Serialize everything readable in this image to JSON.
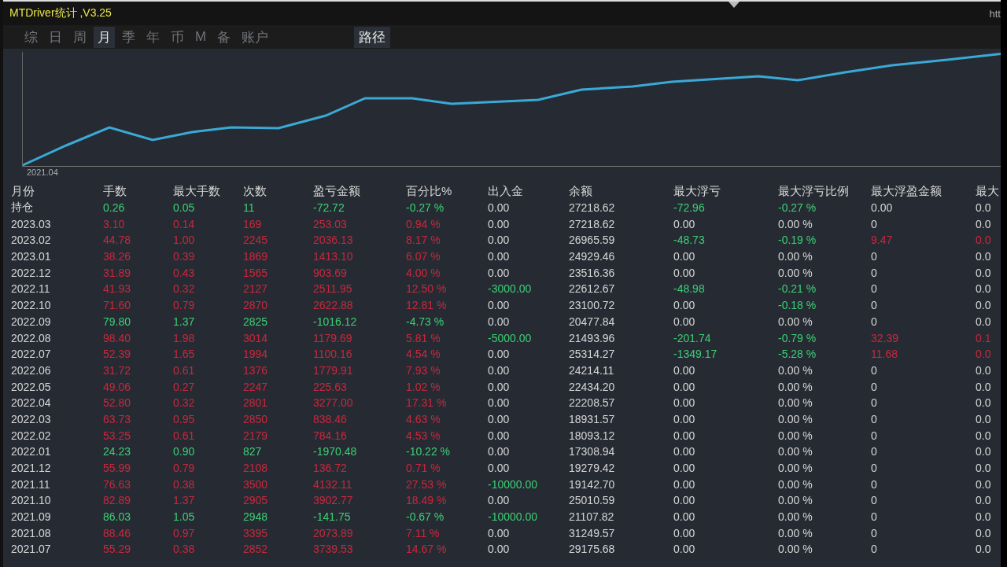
{
  "window": {
    "title": "MTDriver统计 ,V3.25",
    "corner_text": "htt"
  },
  "tabs": [
    {
      "label": "综",
      "selected": false
    },
    {
      "label": "日",
      "selected": false
    },
    {
      "label": "周",
      "selected": false
    },
    {
      "label": "月",
      "selected": true
    },
    {
      "label": "季",
      "selected": false
    },
    {
      "label": "年",
      "selected": false
    },
    {
      "label": "币",
      "selected": false
    },
    {
      "label": "M",
      "selected": false
    },
    {
      "label": "备",
      "selected": false
    },
    {
      "label": "账户",
      "selected": false
    }
  ],
  "path_button": "路径",
  "chart": {
    "start_label": "2021.04"
  },
  "table": {
    "columns": [
      "月份",
      "手数",
      "最大手数",
      "次数",
      "盈亏金额",
      "百分比%",
      "出入金",
      "余额",
      "最大浮亏",
      "最大浮亏比例",
      "最大浮盈金额",
      "最大"
    ],
    "rows": [
      {
        "cells": [
          {
            "text": "持仓",
            "color": "#d6d6d6"
          },
          {
            "text": "0.26",
            "color": "#3ccf74"
          },
          {
            "text": "0.05",
            "color": "#3ccf74"
          },
          {
            "text": "11",
            "color": "#3ccf74"
          },
          {
            "text": "-72.72",
            "color": "#3ccf74"
          },
          {
            "text": "-0.27 %",
            "color": "#3ccf74"
          },
          {
            "text": "0.00",
            "color": "#d6d6d6"
          },
          {
            "text": "27218.62",
            "color": "#d6d6d6"
          },
          {
            "text": "-72.96",
            "color": "#3ccf74"
          },
          {
            "text": "-0.27 %",
            "color": "#3ccf74"
          },
          {
            "text": "0.00",
            "color": "#d6d6d6"
          },
          {
            "text": "0.0",
            "color": "#d6d6d6"
          }
        ]
      },
      {
        "cells": [
          {
            "text": "2023.03",
            "color": "#d6d6d6"
          },
          {
            "text": "3.10",
            "color": "#c8283c"
          },
          {
            "text": "0.14",
            "color": "#c8283c"
          },
          {
            "text": "169",
            "color": "#c8283c"
          },
          {
            "text": "253.03",
            "color": "#c8283c"
          },
          {
            "text": "0.94 %",
            "color": "#c8283c"
          },
          {
            "text": "0.00",
            "color": "#d6d6d6"
          },
          {
            "text": "27218.62",
            "color": "#d6d6d6"
          },
          {
            "text": "0.00",
            "color": "#d6d6d6"
          },
          {
            "text": "0.00 %",
            "color": "#d6d6d6"
          },
          {
            "text": "0",
            "color": "#d6d6d6"
          },
          {
            "text": "0.0",
            "color": "#d6d6d6"
          }
        ]
      },
      {
        "cells": [
          {
            "text": "2023.02",
            "color": "#d6d6d6"
          },
          {
            "text": "44.78",
            "color": "#c8283c"
          },
          {
            "text": "1.00",
            "color": "#c8283c"
          },
          {
            "text": "2245",
            "color": "#c8283c"
          },
          {
            "text": "2036.13",
            "color": "#c8283c"
          },
          {
            "text": "8.17 %",
            "color": "#c8283c"
          },
          {
            "text": "0.00",
            "color": "#d6d6d6"
          },
          {
            "text": "26965.59",
            "color": "#d6d6d6"
          },
          {
            "text": "-48.73",
            "color": "#3ccf74"
          },
          {
            "text": "-0.19 %",
            "color": "#3ccf74"
          },
          {
            "text": "9.47",
            "color": "#c8283c"
          },
          {
            "text": "0.0",
            "color": "#c8283c"
          }
        ]
      },
      {
        "cells": [
          {
            "text": "2023.01",
            "color": "#d6d6d6"
          },
          {
            "text": "38.26",
            "color": "#c8283c"
          },
          {
            "text": "0.39",
            "color": "#c8283c"
          },
          {
            "text": "1869",
            "color": "#c8283c"
          },
          {
            "text": "1413.10",
            "color": "#c8283c"
          },
          {
            "text": "6.07 %",
            "color": "#c8283c"
          },
          {
            "text": "0.00",
            "color": "#d6d6d6"
          },
          {
            "text": "24929.46",
            "color": "#d6d6d6"
          },
          {
            "text": "0.00",
            "color": "#d6d6d6"
          },
          {
            "text": "0.00 %",
            "color": "#d6d6d6"
          },
          {
            "text": "0",
            "color": "#d6d6d6"
          },
          {
            "text": "0.0",
            "color": "#d6d6d6"
          }
        ]
      },
      {
        "cells": [
          {
            "text": "2022.12",
            "color": "#d6d6d6"
          },
          {
            "text": "31.89",
            "color": "#c8283c"
          },
          {
            "text": "0.43",
            "color": "#c8283c"
          },
          {
            "text": "1565",
            "color": "#c8283c"
          },
          {
            "text": "903.69",
            "color": "#c8283c"
          },
          {
            "text": "4.00 %",
            "color": "#c8283c"
          },
          {
            "text": "0.00",
            "color": "#d6d6d6"
          },
          {
            "text": "23516.36",
            "color": "#d6d6d6"
          },
          {
            "text": "0.00",
            "color": "#d6d6d6"
          },
          {
            "text": "0.00 %",
            "color": "#d6d6d6"
          },
          {
            "text": "0",
            "color": "#d6d6d6"
          },
          {
            "text": "0.0",
            "color": "#d6d6d6"
          }
        ]
      },
      {
        "cells": [
          {
            "text": "2022.11",
            "color": "#d6d6d6"
          },
          {
            "text": "41.93",
            "color": "#c8283c"
          },
          {
            "text": "0.32",
            "color": "#c8283c"
          },
          {
            "text": "2127",
            "color": "#c8283c"
          },
          {
            "text": "2511.95",
            "color": "#c8283c"
          },
          {
            "text": "12.50 %",
            "color": "#c8283c"
          },
          {
            "text": "-3000.00",
            "color": "#3ccf74"
          },
          {
            "text": "22612.67",
            "color": "#d6d6d6"
          },
          {
            "text": "-48.98",
            "color": "#3ccf74"
          },
          {
            "text": "-0.21 %",
            "color": "#3ccf74"
          },
          {
            "text": "0",
            "color": "#d6d6d6"
          },
          {
            "text": "0.0",
            "color": "#d6d6d6"
          }
        ]
      },
      {
        "cells": [
          {
            "text": "2022.10",
            "color": "#d6d6d6"
          },
          {
            "text": "71.60",
            "color": "#c8283c"
          },
          {
            "text": "0.79",
            "color": "#c8283c"
          },
          {
            "text": "2870",
            "color": "#c8283c"
          },
          {
            "text": "2622.88",
            "color": "#c8283c"
          },
          {
            "text": "12.81 %",
            "color": "#c8283c"
          },
          {
            "text": "0.00",
            "color": "#d6d6d6"
          },
          {
            "text": "23100.72",
            "color": "#d6d6d6"
          },
          {
            "text": "0.00",
            "color": "#d6d6d6"
          },
          {
            "text": "-0.18 %",
            "color": "#3ccf74"
          },
          {
            "text": "0",
            "color": "#d6d6d6"
          },
          {
            "text": "0.0",
            "color": "#d6d6d6"
          }
        ]
      },
      {
        "cells": [
          {
            "text": "2022.09",
            "color": "#d6d6d6"
          },
          {
            "text": "79.80",
            "color": "#3ccf74"
          },
          {
            "text": "1.37",
            "color": "#3ccf74"
          },
          {
            "text": "2825",
            "color": "#3ccf74"
          },
          {
            "text": "-1016.12",
            "color": "#3ccf74"
          },
          {
            "text": "-4.73 %",
            "color": "#3ccf74"
          },
          {
            "text": "0.00",
            "color": "#d6d6d6"
          },
          {
            "text": "20477.84",
            "color": "#d6d6d6"
          },
          {
            "text": "0.00",
            "color": "#d6d6d6"
          },
          {
            "text": "0.00 %",
            "color": "#d6d6d6"
          },
          {
            "text": "0",
            "color": "#d6d6d6"
          },
          {
            "text": "0.0",
            "color": "#d6d6d6"
          }
        ]
      },
      {
        "cells": [
          {
            "text": "2022.08",
            "color": "#d6d6d6"
          },
          {
            "text": "98.40",
            "color": "#c8283c"
          },
          {
            "text": "1.98",
            "color": "#c8283c"
          },
          {
            "text": "3014",
            "color": "#c8283c"
          },
          {
            "text": "1179.69",
            "color": "#c8283c"
          },
          {
            "text": "5.81 %",
            "color": "#c8283c"
          },
          {
            "text": "-5000.00",
            "color": "#3ccf74"
          },
          {
            "text": "21493.96",
            "color": "#d6d6d6"
          },
          {
            "text": "-201.74",
            "color": "#3ccf74"
          },
          {
            "text": "-0.79 %",
            "color": "#3ccf74"
          },
          {
            "text": "32.39",
            "color": "#c8283c"
          },
          {
            "text": "0.1",
            "color": "#c8283c"
          }
        ]
      },
      {
        "cells": [
          {
            "text": "2022.07",
            "color": "#d6d6d6"
          },
          {
            "text": "52.39",
            "color": "#c8283c"
          },
          {
            "text": "1.65",
            "color": "#c8283c"
          },
          {
            "text": "1994",
            "color": "#c8283c"
          },
          {
            "text": "1100.16",
            "color": "#c8283c"
          },
          {
            "text": "4.54 %",
            "color": "#c8283c"
          },
          {
            "text": "0.00",
            "color": "#d6d6d6"
          },
          {
            "text": "25314.27",
            "color": "#d6d6d6"
          },
          {
            "text": "-1349.17",
            "color": "#3ccf74"
          },
          {
            "text": "-5.28 %",
            "color": "#3ccf74"
          },
          {
            "text": "11.68",
            "color": "#c8283c"
          },
          {
            "text": "0.0",
            "color": "#c8283c"
          }
        ]
      },
      {
        "cells": [
          {
            "text": "2022.06",
            "color": "#d6d6d6"
          },
          {
            "text": "31.72",
            "color": "#c8283c"
          },
          {
            "text": "0.61",
            "color": "#c8283c"
          },
          {
            "text": "1376",
            "color": "#c8283c"
          },
          {
            "text": "1779.91",
            "color": "#c8283c"
          },
          {
            "text": "7.93 %",
            "color": "#c8283c"
          },
          {
            "text": "0.00",
            "color": "#d6d6d6"
          },
          {
            "text": "24214.11",
            "color": "#d6d6d6"
          },
          {
            "text": "0.00",
            "color": "#d6d6d6"
          },
          {
            "text": "0.00 %",
            "color": "#d6d6d6"
          },
          {
            "text": "0",
            "color": "#d6d6d6"
          },
          {
            "text": "0.0",
            "color": "#d6d6d6"
          }
        ]
      },
      {
        "cells": [
          {
            "text": "2022.05",
            "color": "#d6d6d6"
          },
          {
            "text": "49.06",
            "color": "#c8283c"
          },
          {
            "text": "0.27",
            "color": "#c8283c"
          },
          {
            "text": "2247",
            "color": "#c8283c"
          },
          {
            "text": "225.63",
            "color": "#c8283c"
          },
          {
            "text": "1.02 %",
            "color": "#c8283c"
          },
          {
            "text": "0.00",
            "color": "#d6d6d6"
          },
          {
            "text": "22434.20",
            "color": "#d6d6d6"
          },
          {
            "text": "0.00",
            "color": "#d6d6d6"
          },
          {
            "text": "0.00 %",
            "color": "#d6d6d6"
          },
          {
            "text": "0",
            "color": "#d6d6d6"
          },
          {
            "text": "0.0",
            "color": "#d6d6d6"
          }
        ]
      },
      {
        "cells": [
          {
            "text": "2022.04",
            "color": "#d6d6d6"
          },
          {
            "text": "52.80",
            "color": "#c8283c"
          },
          {
            "text": "0.32",
            "color": "#c8283c"
          },
          {
            "text": "2801",
            "color": "#c8283c"
          },
          {
            "text": "3277.00",
            "color": "#c8283c"
          },
          {
            "text": "17.31 %",
            "color": "#c8283c"
          },
          {
            "text": "0.00",
            "color": "#d6d6d6"
          },
          {
            "text": "22208.57",
            "color": "#d6d6d6"
          },
          {
            "text": "0.00",
            "color": "#d6d6d6"
          },
          {
            "text": "0.00 %",
            "color": "#d6d6d6"
          },
          {
            "text": "0",
            "color": "#d6d6d6"
          },
          {
            "text": "0.0",
            "color": "#d6d6d6"
          }
        ]
      },
      {
        "cells": [
          {
            "text": "2022.03",
            "color": "#d6d6d6"
          },
          {
            "text": "63.73",
            "color": "#c8283c"
          },
          {
            "text": "0.95",
            "color": "#c8283c"
          },
          {
            "text": "2850",
            "color": "#c8283c"
          },
          {
            "text": "838.46",
            "color": "#c8283c"
          },
          {
            "text": "4.63 %",
            "color": "#c8283c"
          },
          {
            "text": "0.00",
            "color": "#d6d6d6"
          },
          {
            "text": "18931.57",
            "color": "#d6d6d6"
          },
          {
            "text": "0.00",
            "color": "#d6d6d6"
          },
          {
            "text": "0.00 %",
            "color": "#d6d6d6"
          },
          {
            "text": "0",
            "color": "#d6d6d6"
          },
          {
            "text": "0.0",
            "color": "#d6d6d6"
          }
        ]
      },
      {
        "cells": [
          {
            "text": "2022.02",
            "color": "#d6d6d6"
          },
          {
            "text": "53.25",
            "color": "#c8283c"
          },
          {
            "text": "0.61",
            "color": "#c8283c"
          },
          {
            "text": "2179",
            "color": "#c8283c"
          },
          {
            "text": "784.16",
            "color": "#c8283c"
          },
          {
            "text": "4.53 %",
            "color": "#c8283c"
          },
          {
            "text": "0.00",
            "color": "#d6d6d6"
          },
          {
            "text": "18093.12",
            "color": "#d6d6d6"
          },
          {
            "text": "0.00",
            "color": "#d6d6d6"
          },
          {
            "text": "0.00 %",
            "color": "#d6d6d6"
          },
          {
            "text": "0",
            "color": "#d6d6d6"
          },
          {
            "text": "0.0",
            "color": "#d6d6d6"
          }
        ]
      },
      {
        "cells": [
          {
            "text": "2022.01",
            "color": "#d6d6d6"
          },
          {
            "text": "24.23",
            "color": "#3ccf74"
          },
          {
            "text": "0.90",
            "color": "#3ccf74"
          },
          {
            "text": "827",
            "color": "#3ccf74"
          },
          {
            "text": "-1970.48",
            "color": "#3ccf74"
          },
          {
            "text": "-10.22 %",
            "color": "#3ccf74"
          },
          {
            "text": "0.00",
            "color": "#d6d6d6"
          },
          {
            "text": "17308.94",
            "color": "#d6d6d6"
          },
          {
            "text": "0.00",
            "color": "#d6d6d6"
          },
          {
            "text": "0.00 %",
            "color": "#d6d6d6"
          },
          {
            "text": "0",
            "color": "#d6d6d6"
          },
          {
            "text": "0.0",
            "color": "#d6d6d6"
          }
        ]
      },
      {
        "cells": [
          {
            "text": "2021.12",
            "color": "#d6d6d6"
          },
          {
            "text": "55.99",
            "color": "#c8283c"
          },
          {
            "text": "0.79",
            "color": "#c8283c"
          },
          {
            "text": "2108",
            "color": "#c8283c"
          },
          {
            "text": "136.72",
            "color": "#c8283c"
          },
          {
            "text": "0.71 %",
            "color": "#c8283c"
          },
          {
            "text": "0.00",
            "color": "#d6d6d6"
          },
          {
            "text": "19279.42",
            "color": "#d6d6d6"
          },
          {
            "text": "0.00",
            "color": "#d6d6d6"
          },
          {
            "text": "0.00 %",
            "color": "#d6d6d6"
          },
          {
            "text": "0",
            "color": "#d6d6d6"
          },
          {
            "text": "0.0",
            "color": "#d6d6d6"
          }
        ]
      },
      {
        "cells": [
          {
            "text": "2021.11",
            "color": "#d6d6d6"
          },
          {
            "text": "76.63",
            "color": "#c8283c"
          },
          {
            "text": "0.38",
            "color": "#c8283c"
          },
          {
            "text": "3500",
            "color": "#c8283c"
          },
          {
            "text": "4132.11",
            "color": "#c8283c"
          },
          {
            "text": "27.53 %",
            "color": "#c8283c"
          },
          {
            "text": "-10000.00",
            "color": "#3ccf74"
          },
          {
            "text": "19142.70",
            "color": "#d6d6d6"
          },
          {
            "text": "0.00",
            "color": "#d6d6d6"
          },
          {
            "text": "0.00 %",
            "color": "#d6d6d6"
          },
          {
            "text": "0",
            "color": "#d6d6d6"
          },
          {
            "text": "0.0",
            "color": "#d6d6d6"
          }
        ]
      },
      {
        "cells": [
          {
            "text": "2021.10",
            "color": "#d6d6d6"
          },
          {
            "text": "82.89",
            "color": "#c8283c"
          },
          {
            "text": "1.37",
            "color": "#c8283c"
          },
          {
            "text": "2905",
            "color": "#c8283c"
          },
          {
            "text": "3902.77",
            "color": "#c8283c"
          },
          {
            "text": "18.49 %",
            "color": "#c8283c"
          },
          {
            "text": "0.00",
            "color": "#d6d6d6"
          },
          {
            "text": "25010.59",
            "color": "#d6d6d6"
          },
          {
            "text": "0.00",
            "color": "#d6d6d6"
          },
          {
            "text": "0.00 %",
            "color": "#d6d6d6"
          },
          {
            "text": "0",
            "color": "#d6d6d6"
          },
          {
            "text": "0.0",
            "color": "#d6d6d6"
          }
        ]
      },
      {
        "cells": [
          {
            "text": "2021.09",
            "color": "#d6d6d6"
          },
          {
            "text": "86.03",
            "color": "#3ccf74"
          },
          {
            "text": "1.05",
            "color": "#3ccf74"
          },
          {
            "text": "2948",
            "color": "#3ccf74"
          },
          {
            "text": "-141.75",
            "color": "#3ccf74"
          },
          {
            "text": "-0.67 %",
            "color": "#3ccf74"
          },
          {
            "text": "-10000.00",
            "color": "#3ccf74"
          },
          {
            "text": "21107.82",
            "color": "#d6d6d6"
          },
          {
            "text": "0.00",
            "color": "#d6d6d6"
          },
          {
            "text": "0.00 %",
            "color": "#d6d6d6"
          },
          {
            "text": "0",
            "color": "#d6d6d6"
          },
          {
            "text": "0.0",
            "color": "#d6d6d6"
          }
        ]
      },
      {
        "cells": [
          {
            "text": "2021.08",
            "color": "#d6d6d6"
          },
          {
            "text": "88.46",
            "color": "#c8283c"
          },
          {
            "text": "0.97",
            "color": "#c8283c"
          },
          {
            "text": "3395",
            "color": "#c8283c"
          },
          {
            "text": "2073.89",
            "color": "#c8283c"
          },
          {
            "text": "7.11 %",
            "color": "#c8283c"
          },
          {
            "text": "0.00",
            "color": "#d6d6d6"
          },
          {
            "text": "31249.57",
            "color": "#d6d6d6"
          },
          {
            "text": "0.00",
            "color": "#d6d6d6"
          },
          {
            "text": "0.00 %",
            "color": "#d6d6d6"
          },
          {
            "text": "0",
            "color": "#d6d6d6"
          },
          {
            "text": "0.0",
            "color": "#d6d6d6"
          }
        ]
      },
      {
        "cells": [
          {
            "text": "2021.07",
            "color": "#d6d6d6"
          },
          {
            "text": "55.29",
            "color": "#c8283c"
          },
          {
            "text": "0.38",
            "color": "#c8283c"
          },
          {
            "text": "2852",
            "color": "#c8283c"
          },
          {
            "text": "3739.53",
            "color": "#c8283c"
          },
          {
            "text": "14.67 %",
            "color": "#c8283c"
          },
          {
            "text": "0.00",
            "color": "#d6d6d6"
          },
          {
            "text": "29175.68",
            "color": "#d6d6d6"
          },
          {
            "text": "0.00",
            "color": "#d6d6d6"
          },
          {
            "text": "0.00 %",
            "color": "#d6d6d6"
          },
          {
            "text": "0",
            "color": "#d6d6d6"
          },
          {
            "text": "0.0",
            "color": "#d6d6d6"
          }
        ]
      }
    ]
  }
}
